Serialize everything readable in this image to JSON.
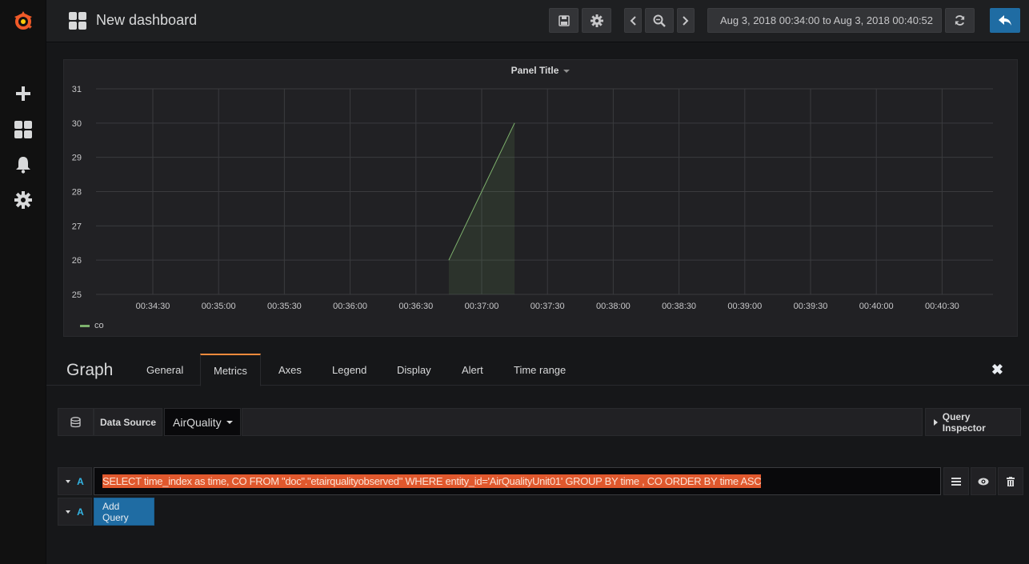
{
  "nav": {
    "dashboard_title": "New dashboard",
    "time_range": "Aug 3, 2018 00:34:00 to Aug 3, 2018 00:40:52"
  },
  "panel": {
    "title": "Panel Title",
    "legend": "co"
  },
  "chart_data": {
    "type": "line",
    "x": [
      "00:36:45",
      "00:37:15"
    ],
    "series": [
      {
        "name": "co",
        "values": [
          26,
          30
        ],
        "color": "#7eb26d"
      }
    ],
    "x_ticks": [
      "00:34:30",
      "00:35:00",
      "00:35:30",
      "00:36:00",
      "00:36:30",
      "00:37:00",
      "00:37:30",
      "00:38:00",
      "00:38:30",
      "00:39:00",
      "00:39:30",
      "00:40:00",
      "00:40:30"
    ],
    "y_ticks": [
      "31",
      "30",
      "29",
      "28",
      "27",
      "26",
      "25"
    ],
    "ylim": [
      25,
      31
    ],
    "grid": true,
    "fill": true,
    "legend_position": "bottom-left"
  },
  "editor": {
    "name": "Graph",
    "tabs": [
      "General",
      "Metrics",
      "Axes",
      "Legend",
      "Display",
      "Alert",
      "Time range"
    ],
    "active_tab": "Metrics"
  },
  "datasource": {
    "label": "Data Source",
    "value": "AirQuality",
    "inspector": "Query Inspector"
  },
  "query": {
    "ref_id": "A",
    "sql": "SELECT time_index as time, CO FROM \"doc\".\"etairqualityobserved\" WHERE entity_id='AirQualityUnit01' GROUP BY time , CO ORDER BY time ASC",
    "add_ref_id": "A",
    "add_label": "Add Query"
  },
  "colors": {
    "accent": "#f58a3c",
    "primary": "#1f6ca3",
    "series": "#7eb26d",
    "highlight": "#e0582d"
  }
}
